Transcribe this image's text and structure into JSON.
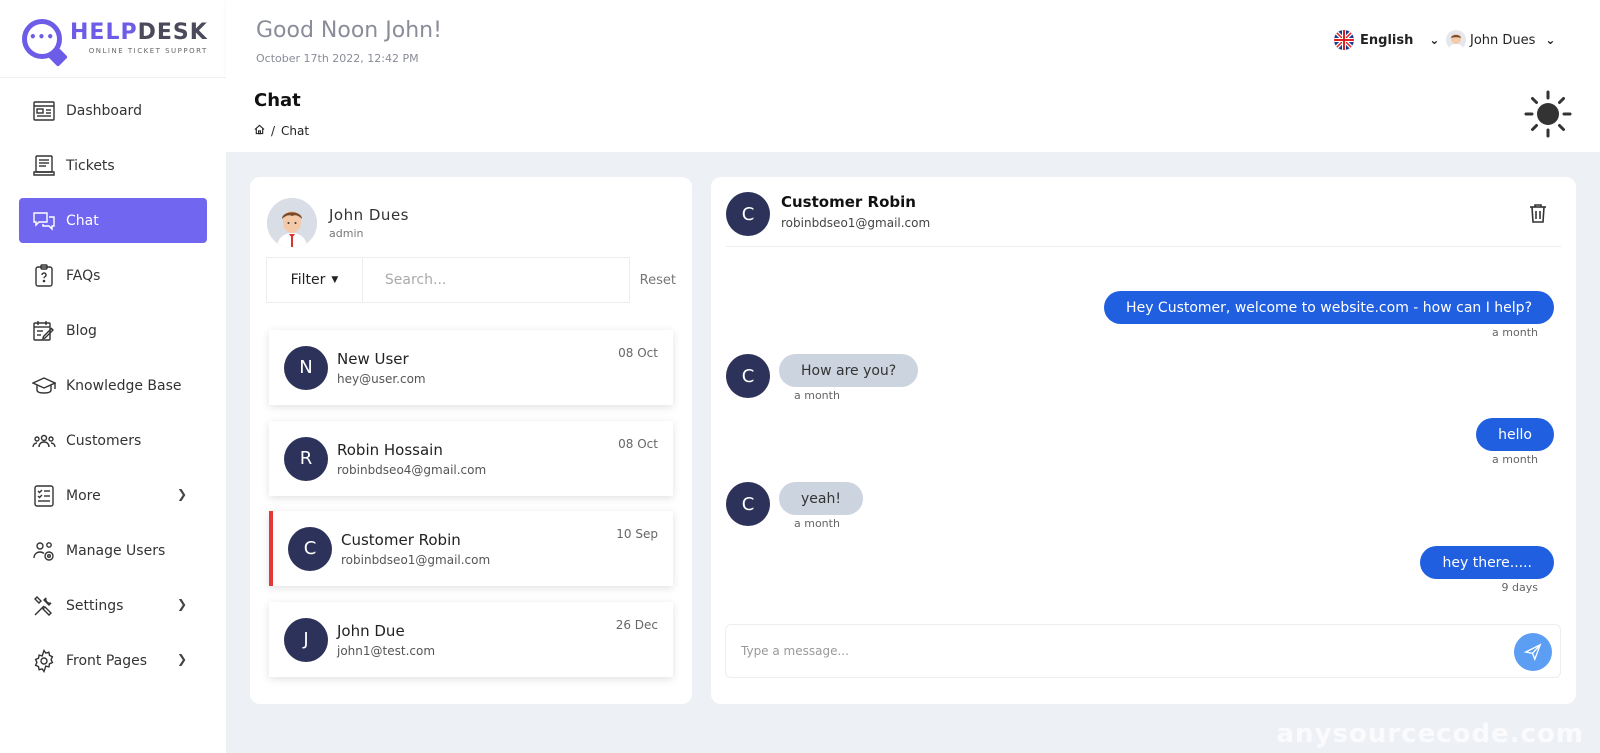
{
  "brand": {
    "title_a": "HELP",
    "title_b": "DESK",
    "subtitle": "ONLINE TICKET SUPPORT",
    "color": "#6c5ce7"
  },
  "sidebar": {
    "items": [
      {
        "label": "Dashboard",
        "icon": "dashboard-icon"
      },
      {
        "label": "Tickets",
        "icon": "tickets-icon"
      },
      {
        "label": "Chat",
        "icon": "chat-icon",
        "active": true
      },
      {
        "label": "FAQs",
        "icon": "faq-icon"
      },
      {
        "label": "Blog",
        "icon": "blog-icon"
      },
      {
        "label": "Knowledge Base",
        "icon": "graduation-cap-icon"
      },
      {
        "label": "Customers",
        "icon": "customers-icon"
      },
      {
        "label": "More",
        "icon": "list-icon",
        "chevron": true
      },
      {
        "label": "Manage Users",
        "icon": "manage-users-icon"
      },
      {
        "label": "Settings",
        "icon": "tools-icon",
        "chevron": true
      },
      {
        "label": "Front Pages",
        "icon": "gear-icon",
        "chevron": true
      }
    ],
    "active_color": "#7166f0"
  },
  "header": {
    "greeting": "Good Noon John!",
    "datetime": "October 17th 2022, 12:42 PM",
    "language": "English",
    "user": "John Dues"
  },
  "page": {
    "title": "Chat",
    "breadcrumb": "Chat"
  },
  "left": {
    "me": {
      "name": "John Dues",
      "role": "admin"
    },
    "filter_label": "Filter",
    "search_placeholder": "Search...",
    "reset_label": "Reset",
    "conversations": [
      {
        "initial": "N",
        "name": "New User",
        "email": "hey@user.com",
        "date": "08 Oct"
      },
      {
        "initial": "R",
        "name": "Robin Hossain",
        "email": "robinbdseo4@gmail.com",
        "date": "08 Oct"
      },
      {
        "initial": "C",
        "name": "Customer Robin",
        "email": "robinbdseo1@gmail.com",
        "date": "10 Sep",
        "active": true
      },
      {
        "initial": "J",
        "name": "John Due",
        "email": "john1@test.com",
        "date": "26 Dec"
      }
    ]
  },
  "chat": {
    "contact": {
      "initial": "C",
      "name": "Customer Robin",
      "email": "robinbdseo1@gmail.com"
    },
    "messages": [
      {
        "dir": "out",
        "text": "Hey Customer, welcome to website.com - how can I help?",
        "time": "a month"
      },
      {
        "dir": "in",
        "text": "How are you?",
        "time": "a month",
        "initial": "C"
      },
      {
        "dir": "out",
        "text": "hello",
        "time": "a month"
      },
      {
        "dir": "in",
        "text": "yeah!",
        "time": "a month",
        "initial": "C"
      },
      {
        "dir": "out",
        "text": "hey there.....",
        "time": "9 days"
      }
    ],
    "input_placeholder": "Type a message...",
    "out_color": "#1f5fe0",
    "in_color": "#ccd4df"
  },
  "watermark": "anysourcecode.com"
}
